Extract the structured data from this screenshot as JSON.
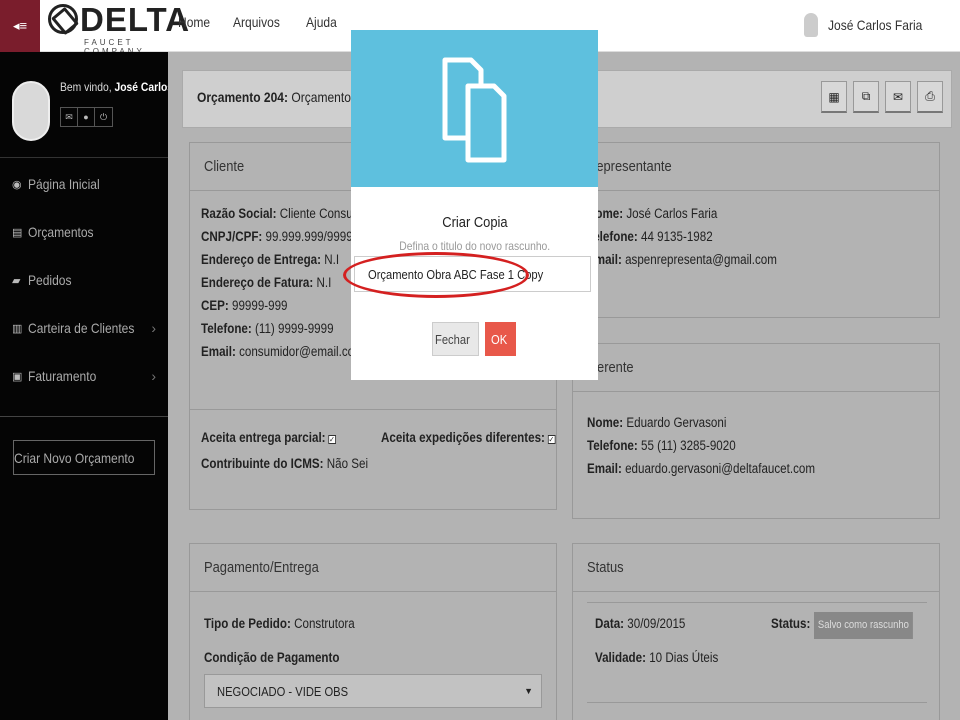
{
  "topbar": {
    "logo_word": "DELTA",
    "logo_sub": "FAUCET COMPANY",
    "toggle_icon": "menu-collapse-icon",
    "nav": [
      "Home",
      "Arquivos",
      "Ajuda"
    ],
    "user_name": "José Carlos Faria"
  },
  "sidebar": {
    "welcome_prefix": "Bem vindo,",
    "welcome_name": "José Carlos",
    "menu": [
      {
        "label": "Página Inicial",
        "icon": "dashboard-icon"
      },
      {
        "label": "Orçamentos",
        "icon": "file-icon"
      },
      {
        "label": "Pedidos",
        "icon": "truck-icon"
      },
      {
        "label": "Carteira de Clientes",
        "icon": "book-icon"
      },
      {
        "label": "Faturamento",
        "icon": "money-icon"
      }
    ],
    "new_button": "Criar Novo Orçamento"
  },
  "header": {
    "title_bold": "Orçamento 204:",
    "title_rest": "Orçamento Obra",
    "tools": [
      "calculator-icon",
      "copy-icon",
      "envelope-icon",
      "print-icon"
    ]
  },
  "cliente": {
    "heading": "Cliente",
    "razao_label": "Razão Social:",
    "razao": "Cliente Consumidor",
    "cnpj_label": "CNPJ/CPF:",
    "cnpj": "99.999.999/9999-99",
    "ent_label": "Endereço de Entrega:",
    "ent": "N.I",
    "fat_label": "Endereço de Fatura:",
    "fat": "N.I",
    "cep_label": "CEP:",
    "cep": "99999-999",
    "tel_label": "Telefone:",
    "tel": "(11) 9999-9999",
    "email_label": "Email:",
    "email": "consumidor@email.com",
    "parcial_label": "Aceita entrega parcial:",
    "exped_label": "Aceita expedições diferentes:",
    "icms_label": "Contribuinte do ICMS:",
    "icms": "Não Sei"
  },
  "representante": {
    "heading": "Representante",
    "name_label": "Nome:",
    "name": "José Carlos Faria",
    "tel_label": "Telefone:",
    "tel": "44 9135-1982",
    "email_label": "Email:",
    "email": "aspenrepresenta@gmail.com"
  },
  "gerente": {
    "heading": "Gerente",
    "name_label": "Nome:",
    "name": "Eduardo Gervasoni",
    "tel_label": "Telefone:",
    "tel": "55 (11) 3285-9020",
    "email_label": "Email:",
    "email": "eduardo.gervasoni@deltafaucet.com"
  },
  "pagamento": {
    "heading": "Pagamento/Entrega",
    "tipo_label": "Tipo de Pedido:",
    "tipo": "Construtora",
    "cond_label": "Condição de Pagamento",
    "cond_value": "NEGOCIADO - VIDE OBS"
  },
  "status": {
    "heading": "Status",
    "data_label": "Data:",
    "data": "30/09/2015",
    "status_label": "Status:",
    "status_badge": "Salvo como rascunho",
    "validade_label": "Validade:",
    "validade": "10 Dias Úteis"
  },
  "modal": {
    "icon": "copy-files-icon",
    "title": "Criar Copia",
    "subtitle": "Defina o titulo do novo rascunho.",
    "input_value": "Orçamento Obra ABC Fase 1 Copy",
    "cancel": "Fechar",
    "ok": "OK",
    "top_color": "#5ec0de",
    "ok_color": "#e8584a",
    "highlight_color": "#d42020"
  }
}
